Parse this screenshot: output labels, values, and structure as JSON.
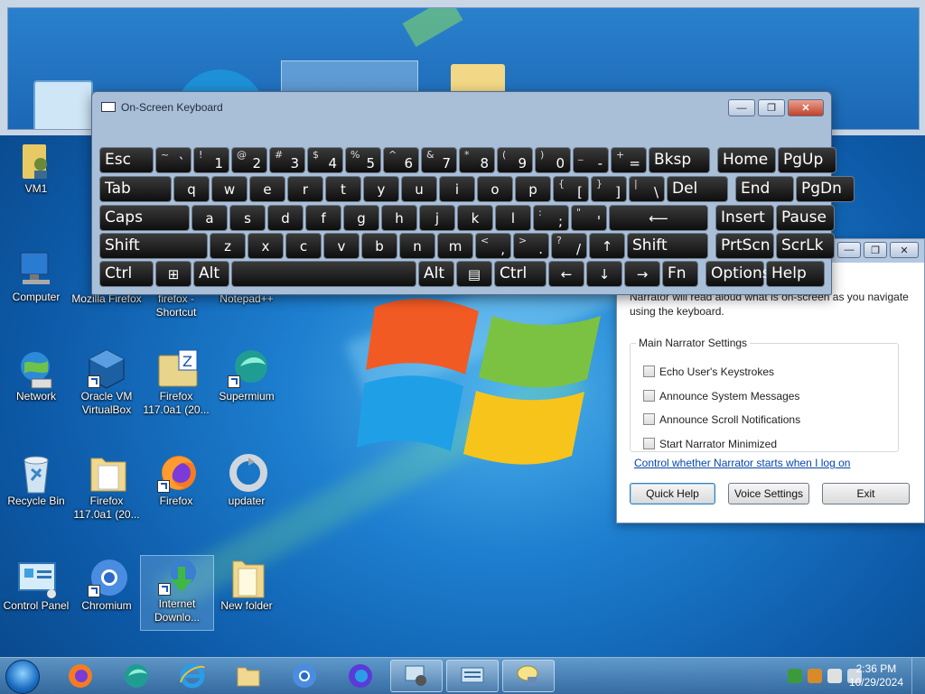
{
  "thumbnail_strip": {},
  "desktop_icons": [
    {
      "label": "VM1"
    },
    {
      "label": "Computer"
    },
    {
      "label": "Mozilla Firefox"
    },
    {
      "label": "firefox - Shortcut"
    },
    {
      "label": "Notepad++"
    },
    {
      "label": "Network"
    },
    {
      "label": "Oracle VM VirtualBox"
    },
    {
      "label": "Firefox 117.0a1 (20..."
    },
    {
      "label": "Supermium"
    },
    {
      "label": "Recycle Bin"
    },
    {
      "label": "Firefox 117.0a1 (20..."
    },
    {
      "label": "Firefox"
    },
    {
      "label": "updater"
    },
    {
      "label": "Control Panel"
    },
    {
      "label": "Chromium"
    },
    {
      "label": "Internet Downlo..."
    },
    {
      "label": "New folder"
    }
  ],
  "osk": {
    "title": "On-Screen Keyboard",
    "controls": {
      "minimize": "—",
      "restore": "❐",
      "close": "✕"
    },
    "rows": [
      [
        {
          "main": "Esc"
        },
        {
          "s": "~",
          "p": "`"
        },
        {
          "s": "!",
          "p": "1"
        },
        {
          "s": "@",
          "p": "2"
        },
        {
          "s": "#",
          "p": "3"
        },
        {
          "s": "$",
          "p": "4"
        },
        {
          "s": "%",
          "p": "5"
        },
        {
          "s": "^",
          "p": "6"
        },
        {
          "s": "&",
          "p": "7"
        },
        {
          "s": "*",
          "p": "8"
        },
        {
          "s": "(",
          "p": "9"
        },
        {
          "s": ")",
          "p": "0"
        },
        {
          "s": "_",
          "p": "-"
        },
        {
          "s": "+",
          "p": "="
        },
        {
          "main": "Bksp"
        },
        {
          "main": "Home"
        },
        {
          "main": "PgUp"
        }
      ],
      [
        {
          "main": "Tab"
        },
        {
          "c": "q"
        },
        {
          "c": "w"
        },
        {
          "c": "e"
        },
        {
          "c": "r"
        },
        {
          "c": "t"
        },
        {
          "c": "y"
        },
        {
          "c": "u"
        },
        {
          "c": "i"
        },
        {
          "c": "o"
        },
        {
          "c": "p"
        },
        {
          "s": "{",
          "p": "["
        },
        {
          "s": "}",
          "p": "]"
        },
        {
          "s": "|",
          "p": "\\"
        },
        {
          "main": "Del"
        },
        {
          "main": "End"
        },
        {
          "main": "PgDn"
        }
      ],
      [
        {
          "main": "Caps"
        },
        {
          "c": "a"
        },
        {
          "c": "s"
        },
        {
          "c": "d"
        },
        {
          "c": "f"
        },
        {
          "c": "g"
        },
        {
          "c": "h"
        },
        {
          "c": "j"
        },
        {
          "c": "k"
        },
        {
          "c": "l"
        },
        {
          "s": ":",
          "p": ";"
        },
        {
          "s": "\"",
          "p": "'"
        },
        {
          "c": "⟵"
        },
        {
          "main": "Insert"
        },
        {
          "main": "Pause"
        }
      ],
      [
        {
          "main": "Shift"
        },
        {
          "c": "z"
        },
        {
          "c": "x"
        },
        {
          "c": "c"
        },
        {
          "c": "v"
        },
        {
          "c": "b"
        },
        {
          "c": "n"
        },
        {
          "c": "m"
        },
        {
          "s": "<",
          "p": ","
        },
        {
          "s": ">",
          "p": "."
        },
        {
          "s": "?",
          "p": "/"
        },
        {
          "c": "↑"
        },
        {
          "main": "Shift"
        },
        {
          "main": "PrtScn"
        },
        {
          "main": "ScrLk"
        }
      ],
      [
        {
          "main": "Ctrl"
        },
        {
          "c": "⊞"
        },
        {
          "main": "Alt"
        },
        {
          "main": ""
        },
        {
          "main": "Alt"
        },
        {
          "c": "▤"
        },
        {
          "main": "Ctrl"
        },
        {
          "c": "←"
        },
        {
          "c": "↓"
        },
        {
          "c": "→"
        },
        {
          "main": "Fn"
        },
        {
          "main": "Options"
        },
        {
          "main": "Help"
        }
      ]
    ]
  },
  "narrator": {
    "controls": {
      "minimize": "—",
      "restore": "❐",
      "close": "✕"
    },
    "description": "Narrator will read aloud what is on-screen as you navigate using the keyboard.",
    "group_label": "Main Narrator Settings",
    "checkboxes": [
      {
        "label": "Echo User's Keystrokes",
        "checked": false
      },
      {
        "label": "Announce System Messages",
        "checked": false
      },
      {
        "label": "Announce Scroll Notifications",
        "checked": false
      },
      {
        "label": "Start Narrator Minimized",
        "checked": false
      }
    ],
    "link": "Control whether Narrator starts when I log on",
    "buttons": {
      "quick_help": "Quick Help",
      "voice_settings": "Voice Settings",
      "exit": "Exit"
    }
  },
  "taskbar": {
    "apps": [
      "firefox-icon",
      "supermium-icon",
      "ie-icon",
      "explorer-icon",
      "chromium-icon",
      "firefox-nightly-icon",
      "narrator-icon",
      "osk-icon",
      "help-icon"
    ],
    "clock": {
      "time": "2:36 PM",
      "date": "10/29/2024"
    }
  },
  "colors": {
    "desktop": "#1e7fd0",
    "osk_key": "#1a1a1a",
    "osk_frame": "#a9bfd8",
    "link": "#0645ad"
  }
}
